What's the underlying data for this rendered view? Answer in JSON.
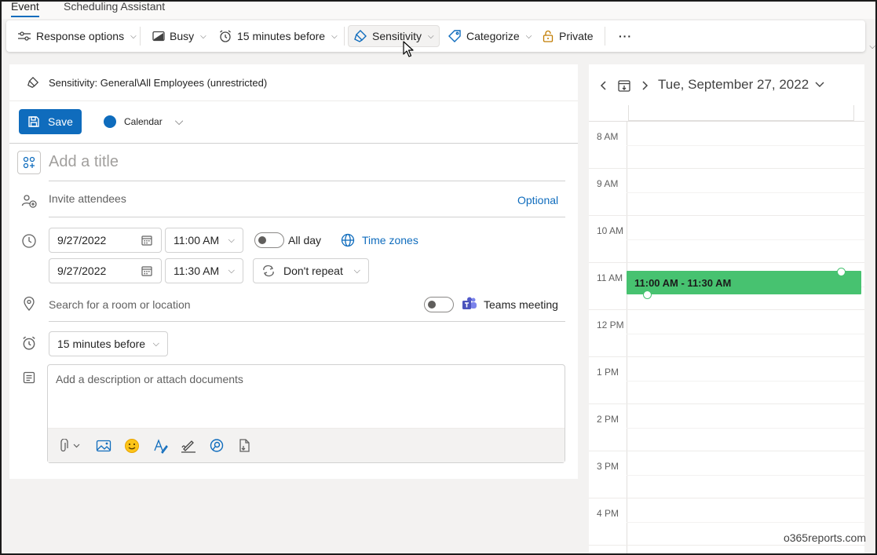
{
  "tabs": [
    {
      "label": "Event",
      "active": true
    },
    {
      "label": "Scheduling Assistant",
      "active": false
    }
  ],
  "ribbon": {
    "response_options": "Response options",
    "busy": "Busy",
    "reminder": "15 minutes before",
    "sensitivity": "Sensitivity",
    "categorize": "Categorize",
    "private": "Private",
    "more": "···"
  },
  "form": {
    "sensitivity_label": "Sensitivity: General\\All Employees (unrestricted)",
    "save_label": "Save",
    "calendar_label": "Calendar",
    "title_placeholder": "Add a title",
    "attendees_placeholder": "Invite attendees",
    "optional_label": "Optional",
    "start_date": "9/27/2022",
    "start_time": "11:00 AM",
    "end_date": "9/27/2022",
    "end_time": "11:30 AM",
    "all_day_label": "All day",
    "time_zones_label": "Time zones",
    "repeat_label": "Don't repeat",
    "location_placeholder": "Search for a room or location",
    "teams_label": "Teams meeting",
    "reminder_value": "15 minutes before",
    "description_placeholder": "Add a description or attach documents"
  },
  "calendar": {
    "date_label": "Tue, September 27, 2022",
    "hours": [
      "8 AM",
      "9 AM",
      "10 AM",
      "11 AM",
      "12 PM",
      "1 PM",
      "2 PM",
      "3 PM",
      "4 PM"
    ],
    "event_label": "11:00 AM - 11:30 AM"
  },
  "watermark": "o365reports.com",
  "colors": {
    "accent": "#0f6cbd",
    "event_green": "#47c270",
    "calendar_dot": "#0f6cbd"
  }
}
